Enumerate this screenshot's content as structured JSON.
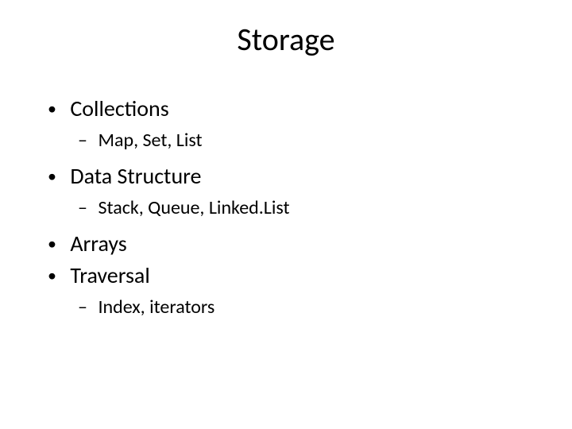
{
  "title": "Storage",
  "bullets": {
    "b1": "Collections",
    "b1_sub": "Map, Set, List",
    "b2": "Data Structure",
    "b2_sub": "Stack, Queue, Linked.List",
    "b3": "Arrays",
    "b4": "Traversal",
    "b4_sub": "Index, iterators"
  }
}
